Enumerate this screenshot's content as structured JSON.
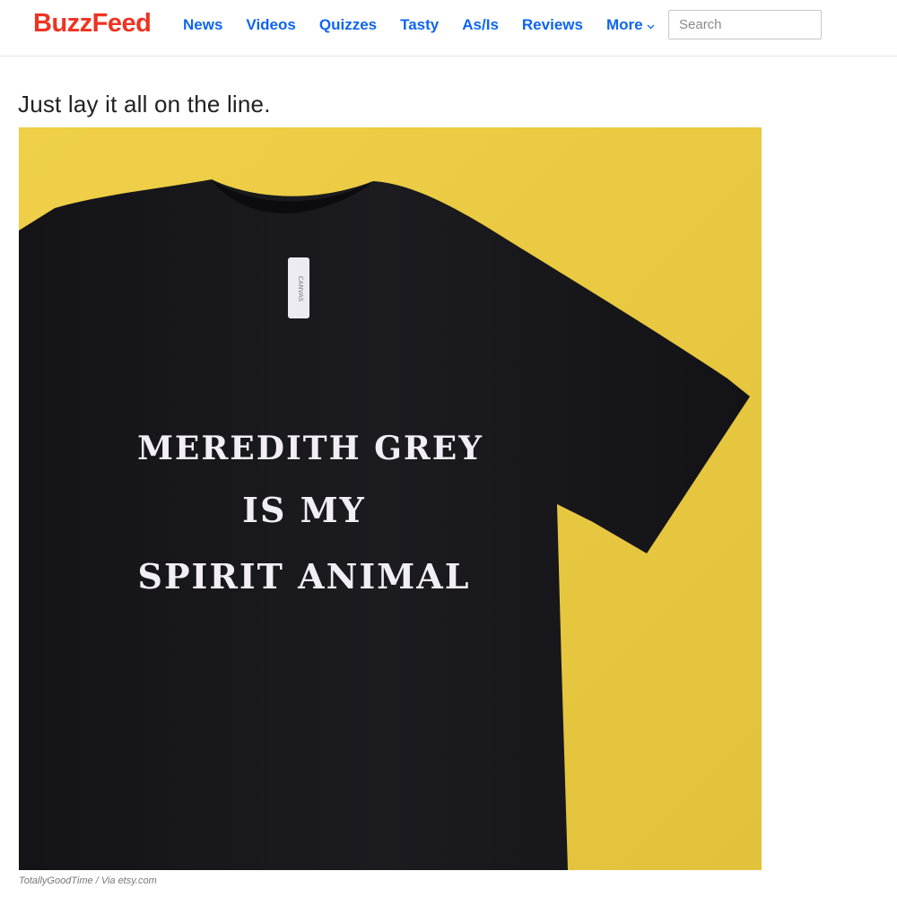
{
  "header": {
    "logo": "BuzzFeed",
    "nav": [
      "News",
      "Videos",
      "Quizzes",
      "Tasty",
      "As/Is",
      "Reviews",
      "More"
    ],
    "search": {
      "placeholder": "Search",
      "value": ""
    }
  },
  "article": {
    "heading": "Just lay it all on the line.",
    "photo": {
      "shirt_lines": [
        "MEREDITH GREY",
        "IS MY",
        "SPIRIT ANIMAL"
      ],
      "tag_text": "CANVAS"
    },
    "credit": "TotallyGoodTime / Via etsy.com"
  },
  "colors": {
    "logo": "#ee3322",
    "nav_link": "#0f65ef",
    "photo_background": "#e8c83a",
    "shirt": "#16161a"
  }
}
